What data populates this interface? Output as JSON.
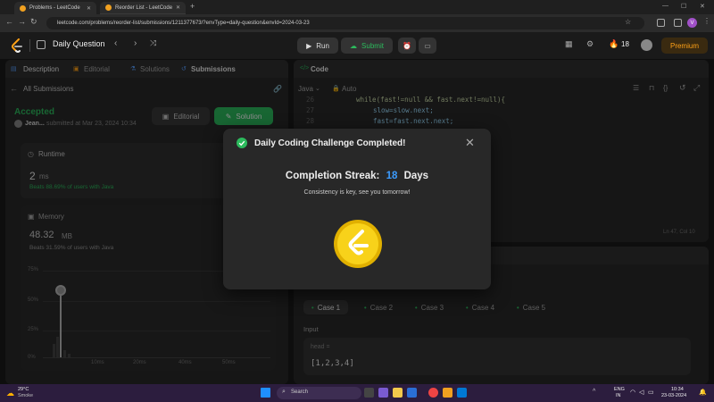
{
  "browser": {
    "tabs": [
      {
        "title": "Problems - LeetCode",
        "active": false
      },
      {
        "title": "Reorder List - LeetCode",
        "active": true
      }
    ],
    "url": "leetcode.com/problems/reorder-list/submissions/1211377673/?envType=daily-question&envId=2024-03-23",
    "profile_initial": "V"
  },
  "header": {
    "title": "Daily Question",
    "run": "Run",
    "submit": "Submit",
    "streak": "18",
    "premium": "Premium"
  },
  "left": {
    "tabs": [
      "Description",
      "Editorial",
      "Solutions",
      "Submissions"
    ],
    "back": "All Submissions",
    "status": "Accepted",
    "user": "Jean...",
    "submitted": "submitted at Mar 23, 2024 10:34",
    "editorial_btn": "Editorial",
    "solution_btn": "Solution",
    "runtime_label": "Runtime",
    "runtime_value": "2",
    "runtime_unit": "ms",
    "runtime_beats": "Beats 88.69% of users with Java",
    "memory_label": "Memory",
    "memory_value": "48.32",
    "memory_unit": "MB",
    "memory_beats": "Beats 31.59% of users with Java",
    "y_ticks": [
      "75%",
      "50%",
      "25%",
      "0%"
    ],
    "x_ticks": [
      "10ms",
      "20ms",
      "40ms",
      "50ms"
    ]
  },
  "editor": {
    "title": "Code",
    "language": "Java",
    "auto": "Auto",
    "lines": [
      {
        "n": "26",
        "text": "while(fast!=null && fast.next!=null){"
      },
      {
        "n": "27",
        "text": "slow=slow.next;"
      },
      {
        "n": "28",
        "text": "fast=fast.next.next;"
      }
    ],
    "cursor": "Ln 47, Col 10"
  },
  "testcase": {
    "cases": [
      "Case 1",
      "Case 2",
      "Case 3",
      "Case 4",
      "Case 5"
    ],
    "input_label": "Input",
    "param": "head =",
    "value": "[1,2,3,4]"
  },
  "modal": {
    "title": "Daily Coding Challenge Completed!",
    "streak_prefix": "Completion Streak:",
    "streak_value": "18",
    "streak_suffix": "Days",
    "message": "Consistency is key, see you tomorrow!"
  },
  "taskbar": {
    "weather_temp": "29°C",
    "weather_desc": "Smoke",
    "search": "Search",
    "lang": "ENG",
    "region": "IN",
    "time": "10:34",
    "date": "23-03-2024"
  },
  "colors": {
    "accent_green": "#2cbb5d",
    "accent_orange": "#ffa116",
    "modal_bg": "#282828"
  }
}
